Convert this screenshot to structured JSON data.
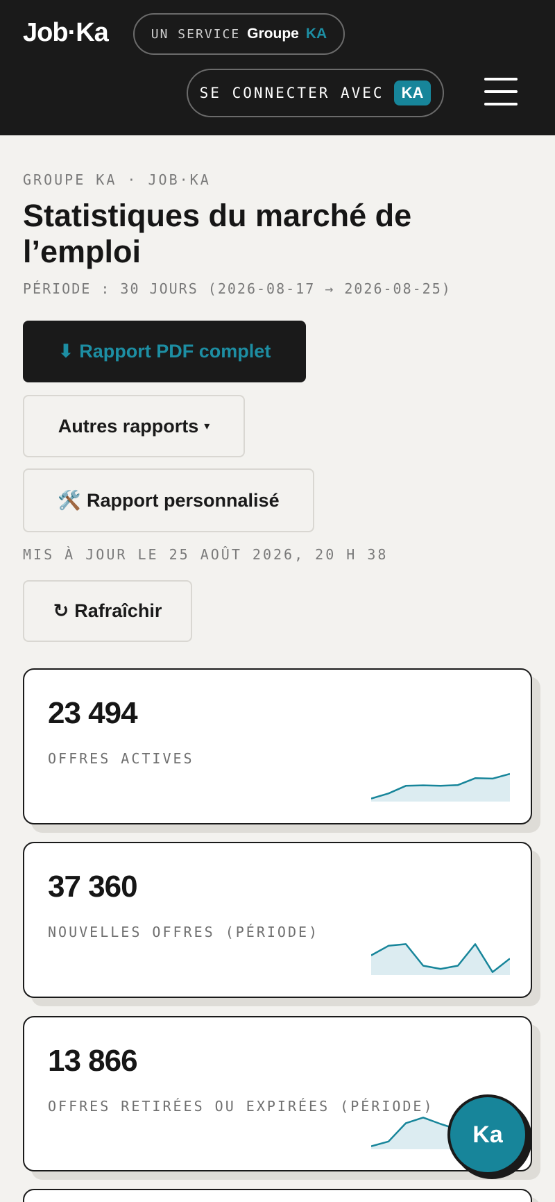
{
  "header": {
    "logo": "Job·Ka",
    "service_label": "UN SERVICE",
    "service_group": "Groupe",
    "service_ka": "KA",
    "connect_label": "SE CONNECTER AVEC",
    "connect_badge": "KA"
  },
  "breadcrumb": "GROUPE KA · JOB·KA",
  "page_title": "Statistiques du marché de l’emploi",
  "period": "PÉRIODE : 30 JOURS (2026-08-17 → 2026-08-25)",
  "buttons": {
    "pdf_icon": "⬇",
    "pdf_label": "Rapport PDF complet",
    "other_label": "Autres rapports",
    "other_caret": "▾",
    "custom_icon": "🛠️",
    "custom_label": "Rapport personnalisé",
    "refresh_icon": "↻",
    "refresh_label": "Rafraîchir"
  },
  "updated": "MIS À JOUR LE 25 AOÛT 2026, 20 H 38",
  "cards": [
    {
      "value": "23 494",
      "label": "OFFRES ACTIVES",
      "sparkline": [
        0.1,
        0.42,
        0.9,
        0.93,
        0.9,
        0.95,
        1.38,
        1.35,
        1.65
      ]
    },
    {
      "value": "37 360",
      "label": "NOUVELLES OFFRES (PÉRIODE)",
      "sparkline": [
        1.15,
        1.75,
        1.85,
        0.5,
        0.3,
        0.5,
        1.85,
        0.1,
        0.95
      ]
    },
    {
      "value": "13 866",
      "label": "OFFRES RETIRÉES OU EXPIRÉES (PÉRIODE)",
      "sparkline": [
        0.1,
        0.4,
        1.55,
        1.9,
        1.5,
        1.15,
        0.9,
        0.75,
        0.7
      ]
    }
  ],
  "fab_label": "Ka",
  "colors": {
    "accent": "#17859a",
    "dark": "#1a1a1a",
    "background": "#f3f2ef",
    "spark_fill": "#dcecf1"
  }
}
